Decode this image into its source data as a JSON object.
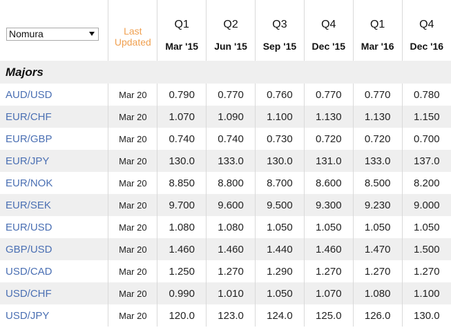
{
  "broker_select": {
    "value": "Nomura"
  },
  "last_updated_label": [
    "Last",
    "Updated"
  ],
  "quarters": [
    {
      "q": "Q1",
      "date": "Mar '15"
    },
    {
      "q": "Q2",
      "date": "Jun '15"
    },
    {
      "q": "Q3",
      "date": "Sep '15"
    },
    {
      "q": "Q4",
      "date": "Dec '15"
    },
    {
      "q": "Q1",
      "date": "Mar '16"
    },
    {
      "q": "Q4",
      "date": "Dec '16"
    }
  ],
  "section_title": "Majors",
  "rows": [
    {
      "pair": "AUD/USD",
      "updated": "Mar 20",
      "values": [
        "0.790",
        "0.770",
        "0.760",
        "0.770",
        "0.770",
        "0.780"
      ]
    },
    {
      "pair": "EUR/CHF",
      "updated": "Mar 20",
      "values": [
        "1.070",
        "1.090",
        "1.100",
        "1.130",
        "1.130",
        "1.150"
      ]
    },
    {
      "pair": "EUR/GBP",
      "updated": "Mar 20",
      "values": [
        "0.740",
        "0.740",
        "0.730",
        "0.720",
        "0.720",
        "0.700"
      ]
    },
    {
      "pair": "EUR/JPY",
      "updated": "Mar 20",
      "values": [
        "130.0",
        "133.0",
        "130.0",
        "131.0",
        "133.0",
        "137.0"
      ]
    },
    {
      "pair": "EUR/NOK",
      "updated": "Mar 20",
      "values": [
        "8.850",
        "8.800",
        "8.700",
        "8.600",
        "8.500",
        "8.200"
      ]
    },
    {
      "pair": "EUR/SEK",
      "updated": "Mar 20",
      "values": [
        "9.700",
        "9.600",
        "9.500",
        "9.300",
        "9.230",
        "9.000"
      ]
    },
    {
      "pair": "EUR/USD",
      "updated": "Mar 20",
      "values": [
        "1.080",
        "1.080",
        "1.050",
        "1.050",
        "1.050",
        "1.050"
      ]
    },
    {
      "pair": "GBP/USD",
      "updated": "Mar 20",
      "values": [
        "1.460",
        "1.460",
        "1.440",
        "1.460",
        "1.470",
        "1.500"
      ]
    },
    {
      "pair": "USD/CAD",
      "updated": "Mar 20",
      "values": [
        "1.250",
        "1.270",
        "1.290",
        "1.270",
        "1.270",
        "1.270"
      ]
    },
    {
      "pair": "USD/CHF",
      "updated": "Mar 20",
      "values": [
        "0.990",
        "1.010",
        "1.050",
        "1.070",
        "1.080",
        "1.100"
      ]
    },
    {
      "pair": "USD/JPY",
      "updated": "Mar 20",
      "values": [
        "120.0",
        "123.0",
        "124.0",
        "125.0",
        "126.0",
        "130.0"
      ]
    }
  ],
  "colors": {
    "link": "#4a6fb3",
    "last_updated": "#f0a050",
    "stripe": "#efefef"
  }
}
